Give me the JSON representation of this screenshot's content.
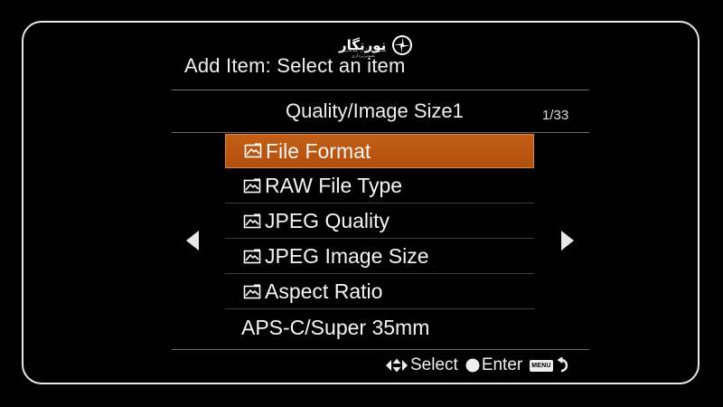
{
  "watermark": {
    "brand": "نورنگار",
    "tagline": "همراه شما در عکاسی و تصویربرداری"
  },
  "header": {
    "title": "Add Item: Select an item"
  },
  "tab": {
    "title": "Quality/Image Size1",
    "page": "1/33"
  },
  "menu": {
    "items": [
      {
        "label": "File Format",
        "icon": "photo-icon",
        "selected": true
      },
      {
        "label": "RAW File Type",
        "icon": "photo-icon",
        "selected": false
      },
      {
        "label": "JPEG Quality",
        "icon": "photo-icon",
        "selected": false
      },
      {
        "label": "JPEG Image Size",
        "icon": "photo-icon",
        "selected": false
      },
      {
        "label": "Aspect Ratio",
        "icon": "photo-icon",
        "selected": false
      },
      {
        "label": "APS-C/Super 35mm",
        "icon": "",
        "selected": false
      }
    ]
  },
  "footer": {
    "select_label": "Select",
    "enter_label": "Enter",
    "menu_key": "MENU"
  },
  "colors": {
    "selection": "#c35f16",
    "background": "#000000",
    "text": "#f2f2f2"
  }
}
